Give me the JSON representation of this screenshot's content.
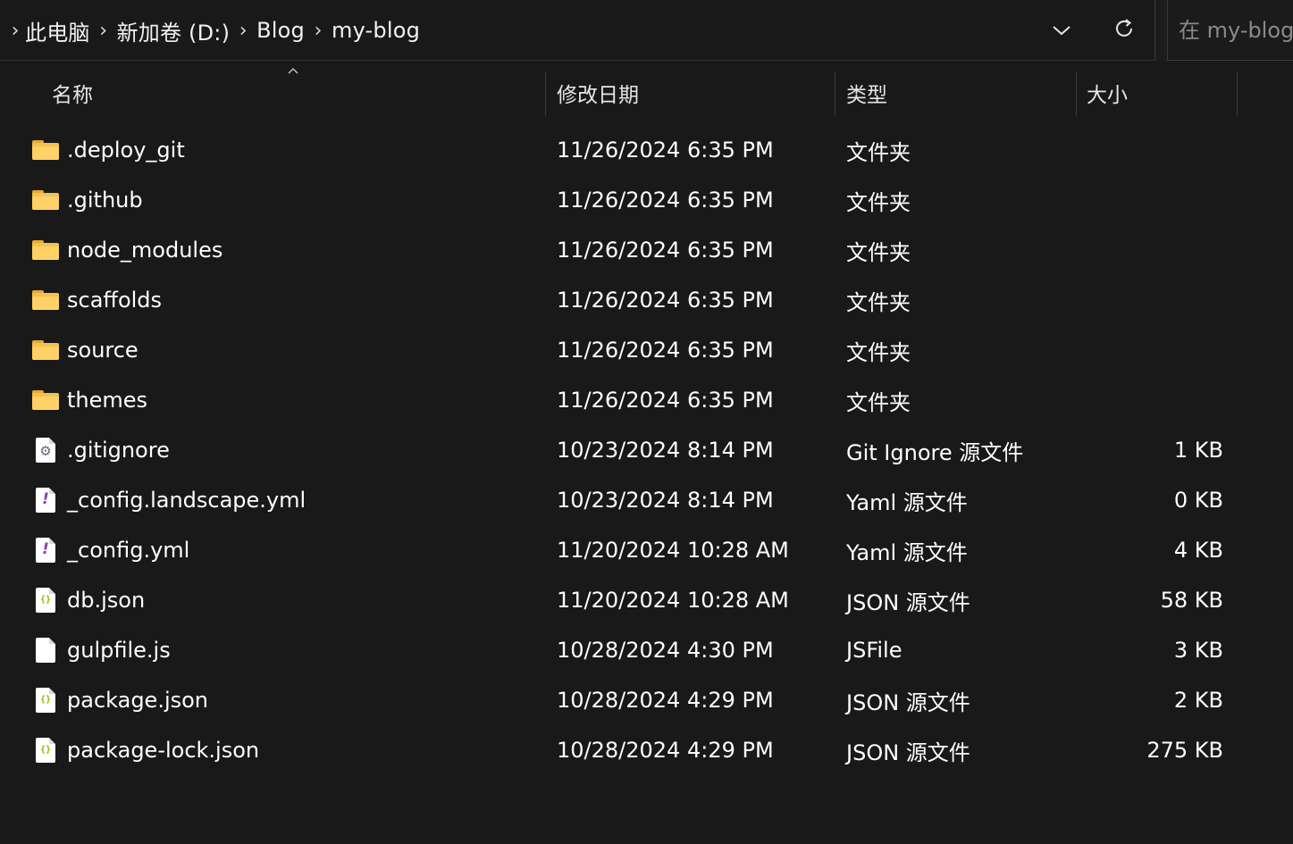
{
  "breadcrumb": {
    "items": [
      "此电脑",
      "新加卷 (D:)",
      "Blog",
      "my-blog"
    ]
  },
  "search": {
    "placeholder": "在 my-blog 中搜索"
  },
  "icons": {
    "dropdown": "chevron-down-icon",
    "refresh": "refresh-icon",
    "sort": "sort-up-caret-icon"
  },
  "columns": {
    "name": "名称",
    "date": "修改日期",
    "type": "类型",
    "size": "大小"
  },
  "files": [
    {
      "name": ".deploy_git",
      "date": "11/26/2024 6:35 PM",
      "type": "文件夹",
      "size": "",
      "icon": "folder-icon"
    },
    {
      "name": ".github",
      "date": "11/26/2024 6:35 PM",
      "type": "文件夹",
      "size": "",
      "icon": "folder-icon"
    },
    {
      "name": "node_modules",
      "date": "11/26/2024 6:35 PM",
      "type": "文件夹",
      "size": "",
      "icon": "folder-icon"
    },
    {
      "name": "scaffolds",
      "date": "11/26/2024 6:35 PM",
      "type": "文件夹",
      "size": "",
      "icon": "folder-icon"
    },
    {
      "name": "source",
      "date": "11/26/2024 6:35 PM",
      "type": "文件夹",
      "size": "",
      "icon": "folder-icon"
    },
    {
      "name": "themes",
      "date": "11/26/2024 6:35 PM",
      "type": "文件夹",
      "size": "",
      "icon": "folder-icon"
    },
    {
      "name": ".gitignore",
      "date": "10/23/2024 8:14 PM",
      "type": "Git Ignore 源文件",
      "size": "1 KB",
      "icon": "gitignore-file-icon"
    },
    {
      "name": "_config.landscape.yml",
      "date": "10/23/2024 8:14 PM",
      "type": "Yaml 源文件",
      "size": "0 KB",
      "icon": "yaml-file-icon"
    },
    {
      "name": "_config.yml",
      "date": "11/20/2024 10:28 AM",
      "type": "Yaml 源文件",
      "size": "4 KB",
      "icon": "yaml-file-icon"
    },
    {
      "name": "db.json",
      "date": "11/20/2024 10:28 AM",
      "type": "JSON 源文件",
      "size": "58 KB",
      "icon": "json-file-icon"
    },
    {
      "name": "gulpfile.js",
      "date": "10/28/2024 4:30 PM",
      "type": "JSFile",
      "size": "3 KB",
      "icon": "blank-file-icon"
    },
    {
      "name": "package.json",
      "date": "10/28/2024 4:29 PM",
      "type": "JSON 源文件",
      "size": "2 KB",
      "icon": "json-file-icon"
    },
    {
      "name": "package-lock.json",
      "date": "10/28/2024 4:29 PM",
      "type": "JSON 源文件",
      "size": "275 KB",
      "icon": "json-file-icon"
    }
  ]
}
